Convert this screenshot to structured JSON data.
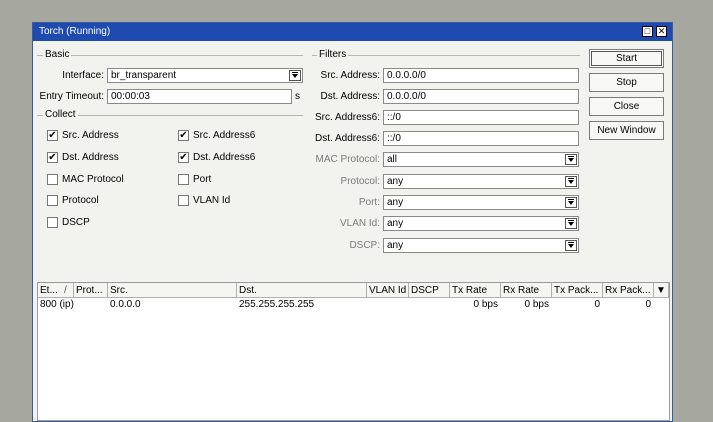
{
  "window": {
    "title": "Torch (Running)",
    "minimize_glyph": "□",
    "close_glyph": "✕"
  },
  "basic": {
    "label": "Basic",
    "interface_label": "Interface:",
    "interface_value": "br_transparent",
    "entry_timeout_label": "Entry Timeout:",
    "entry_timeout_value": "00:00:03",
    "entry_timeout_unit": "s"
  },
  "collect": {
    "label": "Collect",
    "items": [
      {
        "label": "Src. Address",
        "checked": true
      },
      {
        "label": "Dst. Address",
        "checked": true
      },
      {
        "label": "MAC Protocol",
        "checked": false
      },
      {
        "label": "Protocol",
        "checked": false
      },
      {
        "label": "DSCP",
        "checked": false
      },
      {
        "label": "Src. Address6",
        "checked": true
      },
      {
        "label": "Dst. Address6",
        "checked": true
      },
      {
        "label": "Port",
        "checked": false
      },
      {
        "label": "VLAN Id",
        "checked": false
      }
    ],
    "check_glyph": "✔"
  },
  "filters": {
    "label": "Filters",
    "src_address_label": "Src. Address:",
    "src_address_value": "0.0.0.0/0",
    "dst_address_label": "Dst. Address:",
    "dst_address_value": "0.0.0.0/0",
    "src_address6_label": "Src. Address6:",
    "src_address6_value": "::/0",
    "dst_address6_label": "Dst. Address6:",
    "dst_address6_value": "::/0",
    "mac_protocol_label": "MAC Protocol:",
    "mac_protocol_value": "all",
    "protocol_label": "Protocol:",
    "protocol_value": "any",
    "port_label": "Port:",
    "port_value": "any",
    "vlan_id_label": "VLAN Id:",
    "vlan_id_value": "any",
    "dscp_label": "DSCP:",
    "dscp_value": "any"
  },
  "buttons": {
    "start": "Start",
    "stop": "Stop",
    "close": "Close",
    "new_window": "New Window"
  },
  "table": {
    "headers": [
      "Et...",
      "/",
      "Prot...",
      "Src.",
      "Dst.",
      "VLAN Id",
      "DSCP",
      "Tx Rate",
      "Rx Rate",
      "Tx Pack...",
      "Rx Pack..."
    ],
    "menu_glyph": "▼",
    "rows": [
      {
        "eth": "800 (ip)",
        "prot": "",
        "src": "0.0.0.0",
        "dst": "255.255.255.255",
        "vlan": "",
        "dscp": "",
        "tx_rate": "0 bps",
        "rx_rate": "0 bps",
        "tx_pack": "0",
        "rx_pack": "0"
      }
    ]
  }
}
